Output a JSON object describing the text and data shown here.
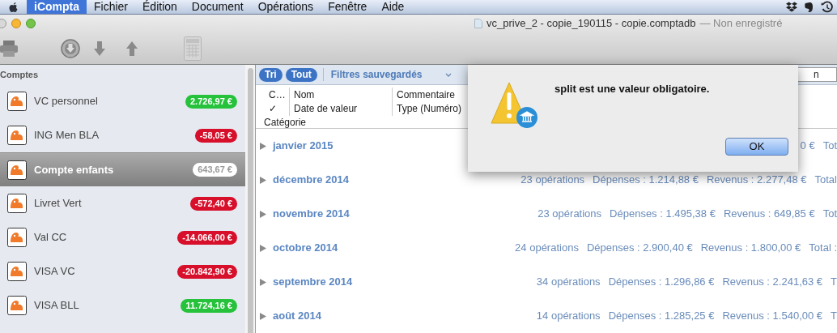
{
  "menubar": {
    "items": [
      {
        "label": "iCompta",
        "selected": true
      },
      {
        "label": "Fichier",
        "selected": false
      },
      {
        "label": "Édition",
        "selected": false
      },
      {
        "label": "Document",
        "selected": false
      },
      {
        "label": "Opérations",
        "selected": false
      },
      {
        "label": "Fenêtre",
        "selected": false
      },
      {
        "label": "Aide",
        "selected": false
      }
    ]
  },
  "window": {
    "title": "vc_prive_2 - copie_190115 - copie.comptadb",
    "subtitle": "— Non enregistré"
  },
  "sidebar": {
    "header": "Comptes",
    "items": [
      {
        "name": "VC personnel",
        "balance": "2.726,97 €",
        "color": "#27c23c",
        "selected": false
      },
      {
        "name": "ING Men BLA",
        "balance": "-58,05 €",
        "color": "#d80f2a",
        "selected": false
      },
      {
        "name": "Compte enfants",
        "balance": "643,67 €",
        "color": "#ffffff",
        "selected": true
      },
      {
        "name": "Livret Vert",
        "balance": "-572,40 €",
        "color": "#d80f2a",
        "selected": false
      },
      {
        "name": "Val CC",
        "balance": "-14.066,00 €",
        "color": "#d80f2a",
        "selected": false
      },
      {
        "name": "VISA VC",
        "balance": "-20.842,90 €",
        "color": "#d80f2a",
        "selected": false
      },
      {
        "name": "VISA BLL",
        "balance": "11.724,16 €",
        "color": "#27c23c",
        "selected": false
      }
    ]
  },
  "filter_bar": {
    "buttons": [
      "Tri",
      "Tout"
    ],
    "saved_filters": "Filtres sauvegardés"
  },
  "search_field": {
    "value": "n"
  },
  "columns": [
    [
      "C…",
      "Nom",
      "Commentaire"
    ],
    [
      "✓",
      "Date de valeur",
      "Type (Numéro)"
    ],
    [
      "Catégorie"
    ]
  ],
  "months": [
    {
      "label": "janvier 2015",
      "stats": [
        "0 €",
        "Tot"
      ]
    },
    {
      "label": "décembre 2014",
      "stats": [
        "23 opérations",
        "Dépenses : 1.214,88 €",
        "Revenus : 2.277,48 €",
        "Total"
      ]
    },
    {
      "label": "novembre 2014",
      "stats": [
        "23 opérations",
        "Dépenses : 1.495,38 €",
        "Revenus : 649,85 €",
        "Tot"
      ]
    },
    {
      "label": "octobre 2014",
      "stats": [
        "24 opérations",
        "Dépenses : 2.900,40 €",
        "Revenus : 1.800,00 €",
        "Total :"
      ]
    },
    {
      "label": "septembre 2014",
      "stats": [
        "34 opérations",
        "Dépenses : 1.296,86 €",
        "Revenus : 2.241,63 €",
        "T"
      ]
    },
    {
      "label": "août 2014",
      "stats": [
        "14 opérations",
        "Dépenses : 1.285,25 €",
        "Revenus : 1.540,00 €",
        "T"
      ]
    }
  ],
  "dialog": {
    "message": "split est une valeur obligatoire.",
    "button": "OK"
  }
}
